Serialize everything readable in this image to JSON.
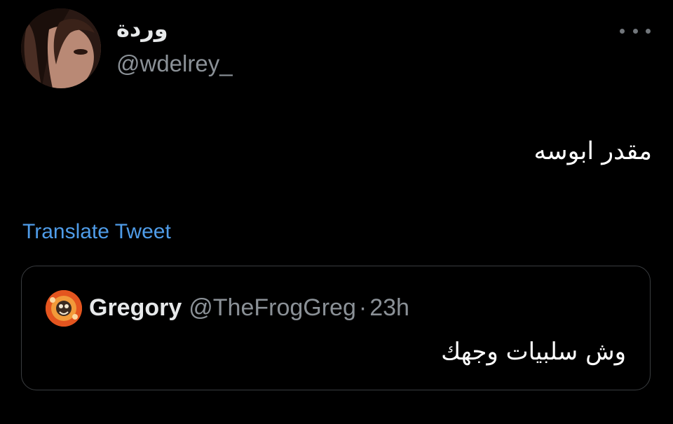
{
  "author": {
    "display_name": "وردة",
    "handle": "@wdelrey_"
  },
  "tweet": {
    "text": "مقدر ابوسه",
    "translate_label": "Translate Tweet"
  },
  "quoted_tweet": {
    "display_name": "Gregory",
    "handle": "@TheFrogGreg",
    "separator": "·",
    "time": "23h",
    "text": "وش سلبيات وجهك"
  },
  "colors": {
    "background": "#000000",
    "link": "#4f9ce8",
    "secondary_text": "#8b9197",
    "border": "#3a3d40"
  },
  "icons": {
    "more": "more-horizontal-icon"
  }
}
